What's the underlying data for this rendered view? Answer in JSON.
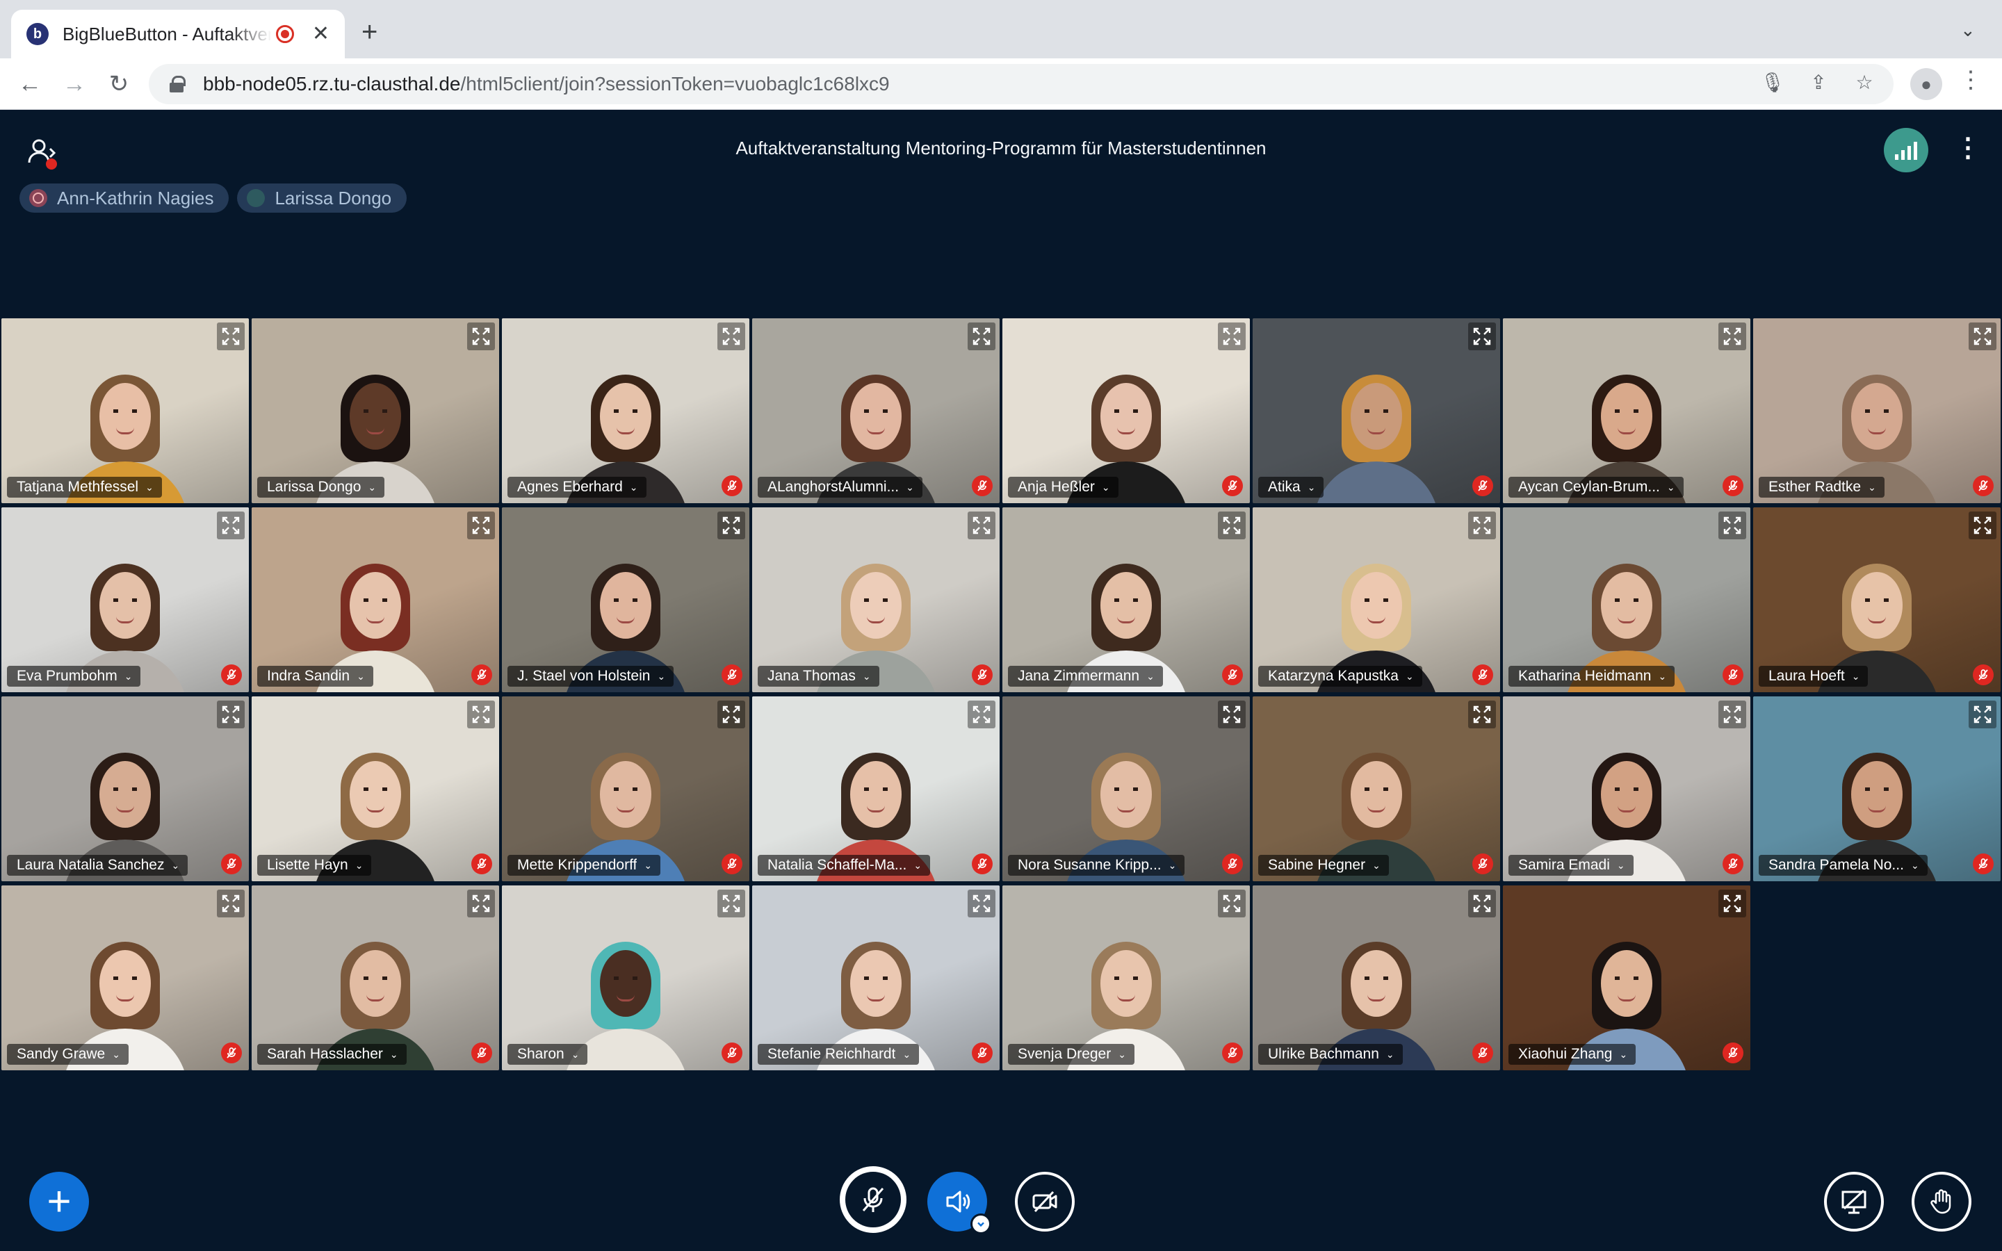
{
  "browser": {
    "tab_title": "BigBlueButton - Auftaktveranstaltung",
    "favicon_letter": "b",
    "close_glyph": "✕",
    "new_tab_glyph": "+",
    "tab_search_glyph": "⌄",
    "url_host": "bbb-node05.rz.tu-clausthal.de",
    "url_path": "/html5client/join?sessionToken=vuobaglc1c68lxc9",
    "back_glyph": "←",
    "forward_glyph": "→",
    "reload_glyph": "↻",
    "mic_glyph": "🎙",
    "share_glyph": "⇪",
    "star_glyph": "☆",
    "menu_glyph": "⋮"
  },
  "meeting": {
    "title": "Auftaktveranstaltung Mentoring-Programm für Masterstudentinnen",
    "options_glyph": "⋮"
  },
  "talkers": [
    {
      "name": "Ann-Kathrin Nagies",
      "muted": true
    },
    {
      "name": "Larissa Dongo",
      "muted": false
    }
  ],
  "colors": {
    "app_bg": "#06172A",
    "primary": "#0F70D7",
    "danger": "#DF2721",
    "connection": "#3D9A8D"
  },
  "participants": [
    {
      "name": "Tatjana Methfessel",
      "muted": false,
      "bg": "#D9D2C4",
      "hair": "#7A5636",
      "skin": "#E8BFA6",
      "shirt": "#D79A34"
    },
    {
      "name": "Larissa Dongo",
      "muted": false,
      "bg": "#B9AE9E",
      "hair": "#1B1210",
      "skin": "#5E3A28",
      "shirt": "#D8D3CC"
    },
    {
      "name": "Agnes Eberhard",
      "muted": true,
      "bg": "#D8D4CB",
      "hair": "#3A2417",
      "skin": "#E6C2AA",
      "shirt": "#2E2A2A"
    },
    {
      "name": "ALanghorstAlumni...",
      "muted": true,
      "bg": "#A9A69E",
      "hair": "#5B3626",
      "skin": "#E2B7A1",
      "shirt": "#3A3A3A"
    },
    {
      "name": "Anja Heßler",
      "muted": true,
      "bg": "#E4DED3",
      "hair": "#5A3C2A",
      "skin": "#E7C2AE",
      "shirt": "#1C1C1C"
    },
    {
      "name": "Atika",
      "muted": true,
      "bg": "#4E5358",
      "hair": "#C88C3A",
      "skin": "#C99A7A",
      "shirt": "#5E6F88"
    },
    {
      "name": "Aycan Ceylan-Brum...",
      "muted": true,
      "bg": "#BDB7AB",
      "hair": "#2C1A12",
      "skin": "#D9A98B",
      "shirt": "#4A3F36"
    },
    {
      "name": "Esther Radtke",
      "muted": true,
      "bg": "#B7A597",
      "hair": "#8A6B55",
      "skin": "#D4A890",
      "shirt": "#8B7868"
    },
    {
      "name": "Eva Prumbohm",
      "muted": true,
      "bg": "#D7D7D5",
      "hair": "#4C3121",
      "skin": "#E4C0A8",
      "shirt": "#B5B0AB"
    },
    {
      "name": "Indra Sandin",
      "muted": true,
      "bg": "#BDA48C",
      "hair": "#7A2E22",
      "skin": "#E6C3AC",
      "shirt": "#E9E4D8"
    },
    {
      "name": "J. Stael von Holstein",
      "muted": true,
      "bg": "#7E7A70",
      "hair": "#2F2019",
      "skin": "#E0B59D",
      "shirt": "#233246"
    },
    {
      "name": "Jana Thomas",
      "muted": true,
      "bg": "#CFCCC6",
      "hair": "#C3A27A",
      "skin": "#EDCDB9",
      "shirt": "#9DA29D"
    },
    {
      "name": "Jana Zimmermann",
      "muted": true,
      "bg": "#B4B0A6",
      "hair": "#3E2A1E",
      "skin": "#E4BFA6",
      "shirt": "#EEEEEE"
    },
    {
      "name": "Katarzyna Kapustka",
      "muted": true,
      "bg": "#C8C1B5",
      "hair": "#D8BE8E",
      "skin": "#EDC8B0",
      "shirt": "#1E1E22"
    },
    {
      "name": "Katharina Heidmann",
      "muted": true,
      "bg": "#9FA19D",
      "hair": "#6B4A33",
      "skin": "#E3BCA2",
      "shirt": "#C9883A"
    },
    {
      "name": "Laura Hoeft",
      "muted": true,
      "bg": "#6C4A2E",
      "hair": "#B08A5C",
      "skin": "#E7C3A8",
      "shirt": "#2A2A2A"
    },
    {
      "name": "Laura Natalia Sanchez",
      "muted": true,
      "bg": "#A6A39F",
      "hair": "#2C1D16",
      "skin": "#D6AC92",
      "shirt": "#5E5C5A"
    },
    {
      "name": "Lisette Hayn",
      "muted": true,
      "bg": "#E1DDD4",
      "hair": "#8E6A45",
      "skin": "#EBCAB3",
      "shirt": "#222222"
    },
    {
      "name": "Mette Krippendorff",
      "muted": true,
      "bg": "#6F6456",
      "hair": "#8A6A4A",
      "skin": "#E0B8A0",
      "shirt": "#4E7FB6"
    },
    {
      "name": "Natalia Schaffel-Ma...",
      "muted": true,
      "bg": "#DFE2E0",
      "hair": "#3B2A20",
      "skin": "#E6C0A8",
      "shirt": "#C4473E"
    },
    {
      "name": "Nora Susanne Kripp...",
      "muted": true,
      "bg": "#6E6A65",
      "hair": "#9B7A55",
      "skin": "#E3BDA5",
      "shirt": "#3A5677"
    },
    {
      "name": "Sabine Hegner",
      "muted": true,
      "bg": "#7A6248",
      "hair": "#6D4B30",
      "skin": "#E2BAA0",
      "shirt": "#2E3E3C"
    },
    {
      "name": "Samira Emadi",
      "muted": true,
      "bg": "#B9B6B2",
      "hair": "#241713",
      "skin": "#D2A183",
      "shirt": "#EDEAE6"
    },
    {
      "name": "Sandra Pamela No...",
      "muted": true,
      "bg": "#5E8EA3",
      "hair": "#3A2418",
      "skin": "#CF9E80",
      "shirt": "#2B2B2B"
    },
    {
      "name": "Sandy Grawe",
      "muted": true,
      "bg": "#BDB4A8",
      "hair": "#6E4A30",
      "skin": "#ECC7AF",
      "shirt": "#F2F0EC"
    },
    {
      "name": "Sarah Hasslacher",
      "muted": true,
      "bg": "#B5B0A8",
      "hair": "#7C5A3E",
      "skin": "#E2BCA3",
      "shirt": "#2F3F33"
    },
    {
      "name": "Sharon",
      "muted": true,
      "bg": "#D6D3CD",
      "hair": "#4FB7B5",
      "skin": "#4A2E22",
      "shirt": "#E8E4DC"
    },
    {
      "name": "Stefanie Reichhardt",
      "muted": true,
      "bg": "#C8CDD3",
      "hair": "#7E5D42",
      "skin": "#EBC8B2",
      "shirt": "#F1F1F1"
    },
    {
      "name": "Svenja Dreger",
      "muted": true,
      "bg": "#B7B4AC",
      "hair": "#9A7B5A",
      "skin": "#E8C5AD",
      "shirt": "#F2EFEA"
    },
    {
      "name": "Ulrike Bachmann",
      "muted": true,
      "bg": "#8E8983",
      "hair": "#5A3C28",
      "skin": "#E6C2AA",
      "shirt": "#2C3A55"
    },
    {
      "name": "Xiaohui Zhang",
      "muted": true,
      "bg": "#5E3A24",
      "hair": "#1B1412",
      "skin": "#E0B598",
      "shirt": "#7E9BBE"
    }
  ],
  "actions": {
    "plus_glyph": "+",
    "caret_glyph": "⌄"
  }
}
